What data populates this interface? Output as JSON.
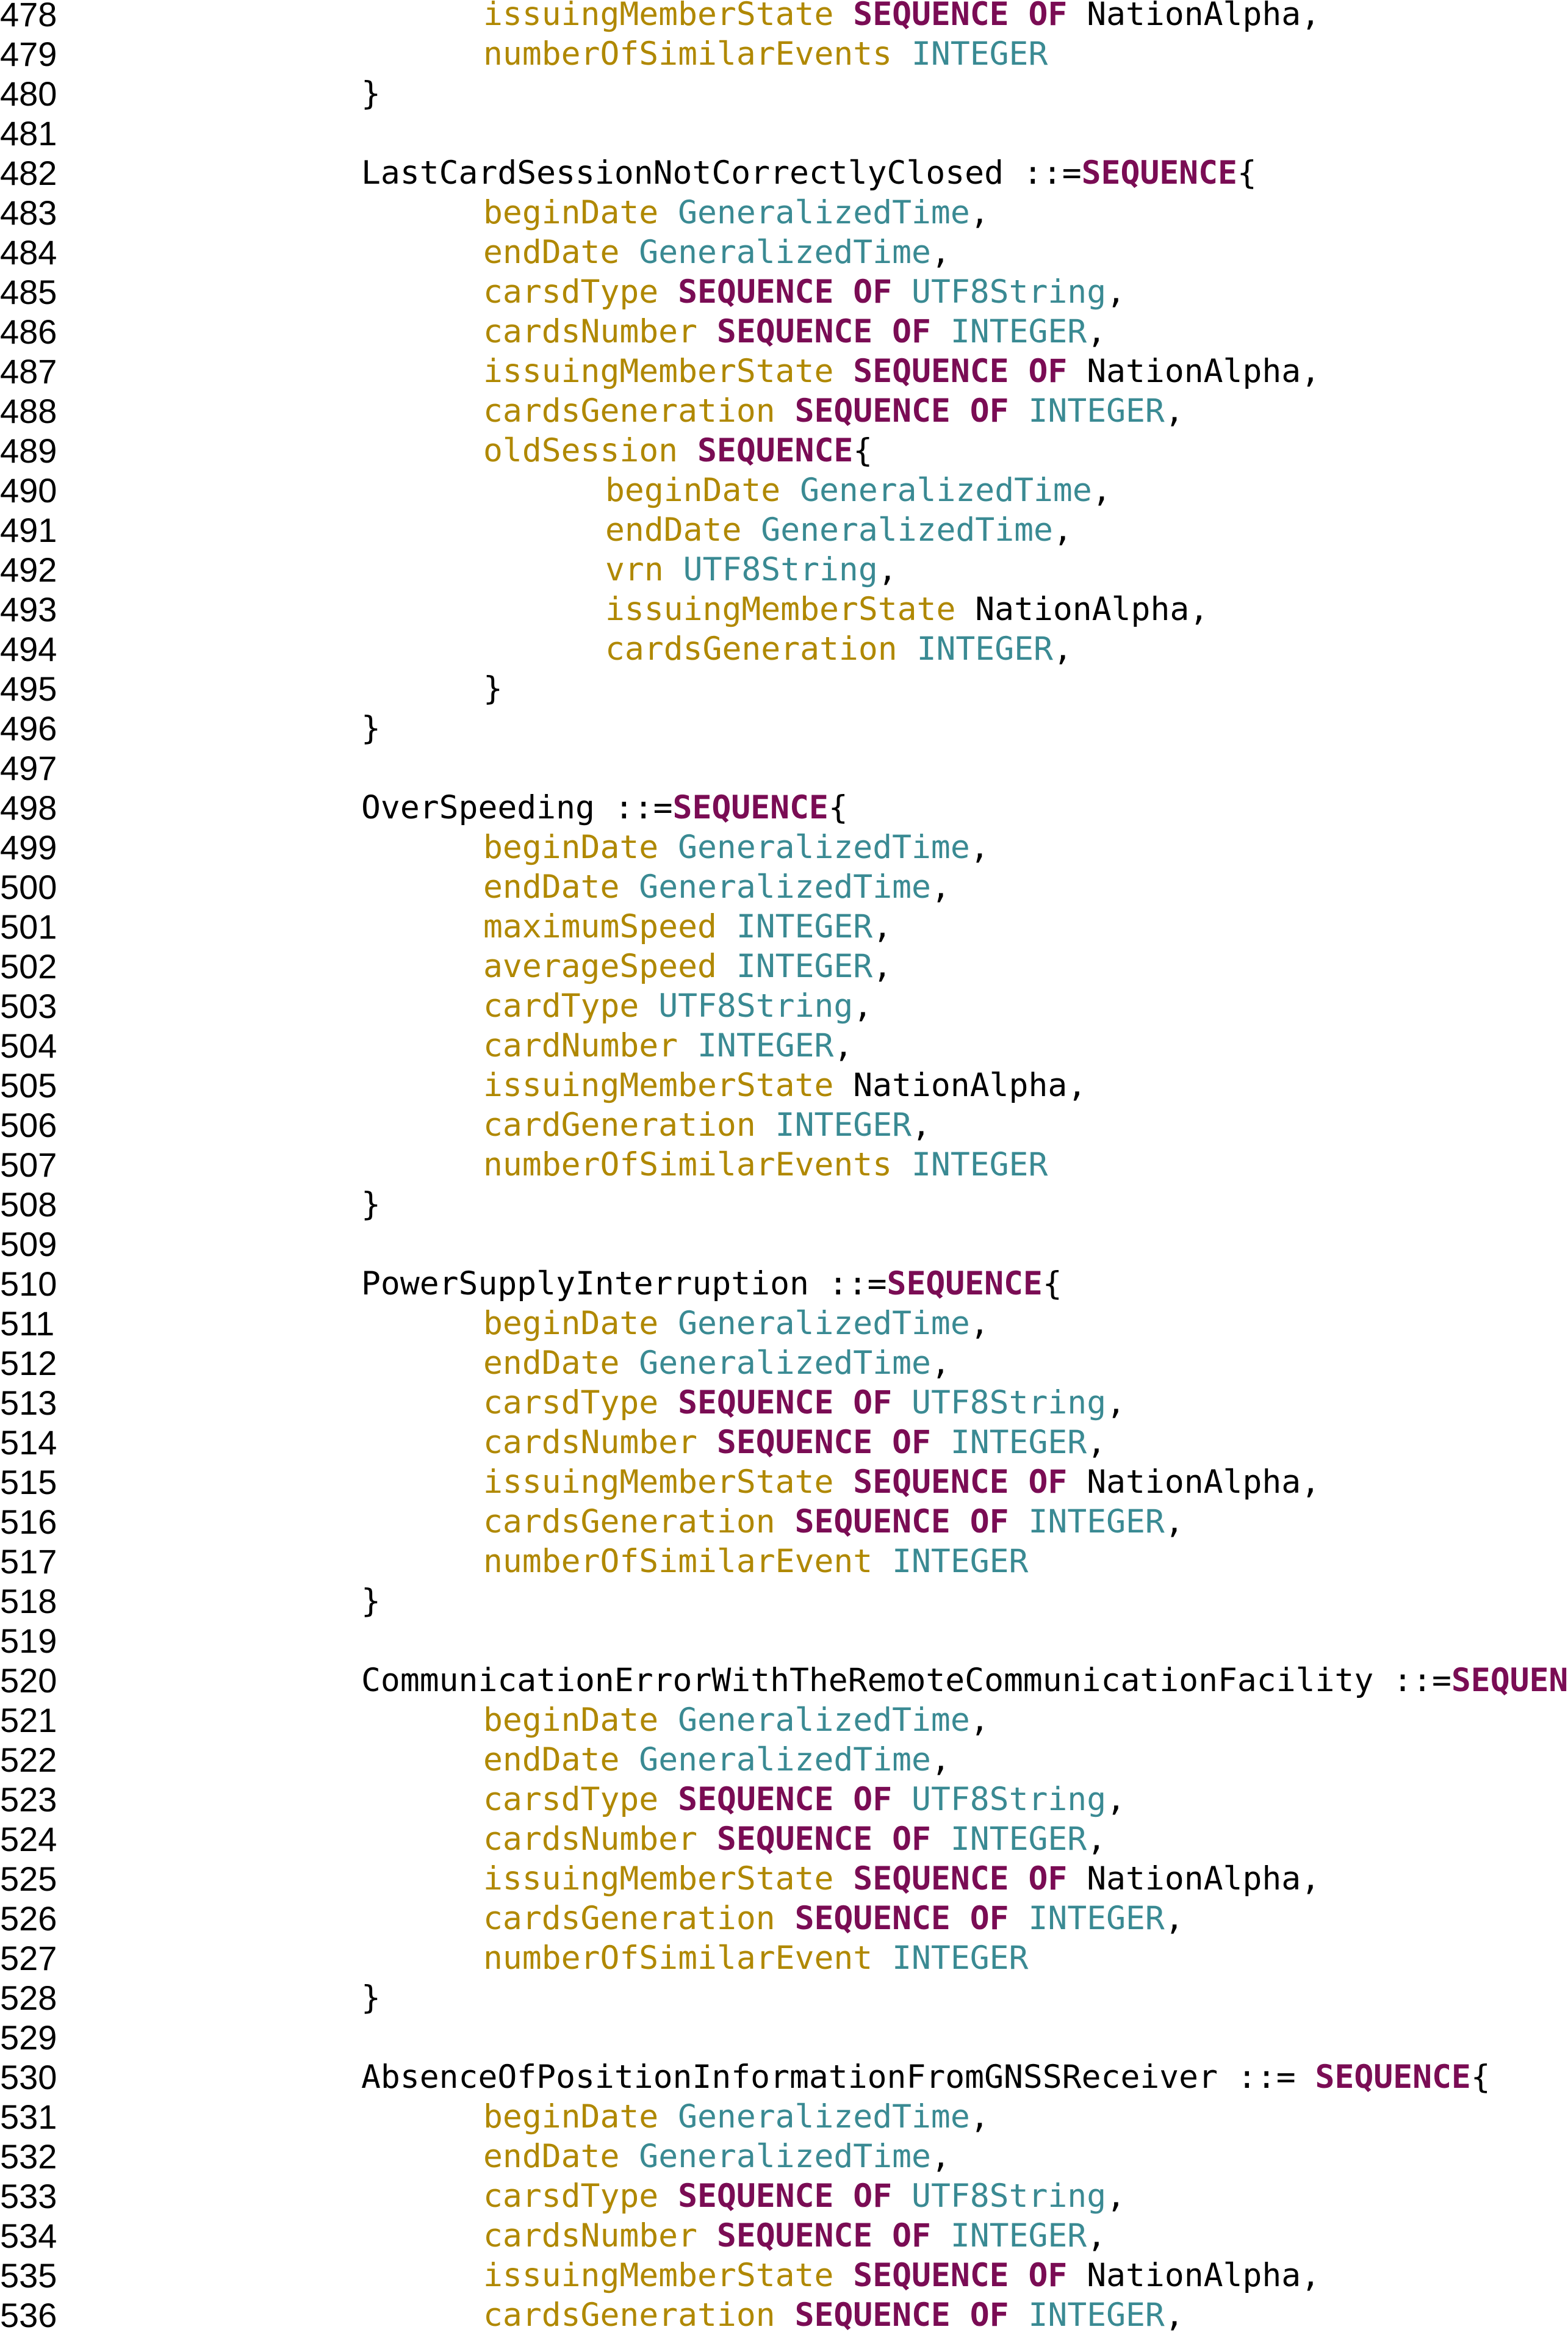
{
  "document": {
    "colors": {
      "plain": "#000000",
      "field": "#b08800",
      "type": "#3a8a93",
      "keyword": "#7a0c54"
    },
    "lines": [
      {
        "n": "478",
        "indent": 2,
        "tokens": [
          [
            "f",
            "issuingMemberState"
          ],
          [
            "p",
            " "
          ],
          [
            "k",
            "SEQUENCE OF"
          ],
          [
            "p",
            " NationAlpha,"
          ]
        ]
      },
      {
        "n": "479",
        "indent": 2,
        "tokens": [
          [
            "f",
            "numberOfSimilarEvents"
          ],
          [
            "p",
            " "
          ],
          [
            "t",
            "INTEGER"
          ]
        ]
      },
      {
        "n": "480",
        "indent": 1,
        "tokens": [
          [
            "p",
            "}"
          ]
        ]
      },
      {
        "n": "481",
        "indent": 0,
        "tokens": []
      },
      {
        "n": "482",
        "indent": 1,
        "tokens": [
          [
            "p",
            "LastCardSessionNotCorrectlyClosed ::="
          ],
          [
            "k",
            "SEQUENCE"
          ],
          [
            "p",
            "{"
          ]
        ]
      },
      {
        "n": "483",
        "indent": 2,
        "tokens": [
          [
            "f",
            "beginDate"
          ],
          [
            "p",
            " "
          ],
          [
            "t",
            "GeneralizedTime"
          ],
          [
            "p",
            ","
          ]
        ]
      },
      {
        "n": "484",
        "indent": 2,
        "tokens": [
          [
            "f",
            "endDate"
          ],
          [
            "p",
            " "
          ],
          [
            "t",
            "GeneralizedTime"
          ],
          [
            "p",
            ","
          ]
        ]
      },
      {
        "n": "485",
        "indent": 2,
        "tokens": [
          [
            "f",
            "carsdType"
          ],
          [
            "p",
            " "
          ],
          [
            "k",
            "SEQUENCE OF"
          ],
          [
            "p",
            " "
          ],
          [
            "t",
            "UTF8String"
          ],
          [
            "p",
            ","
          ]
        ]
      },
      {
        "n": "486",
        "indent": 2,
        "tokens": [
          [
            "f",
            "cardsNumber"
          ],
          [
            "p",
            " "
          ],
          [
            "k",
            "SEQUENCE OF"
          ],
          [
            "p",
            " "
          ],
          [
            "t",
            "INTEGER"
          ],
          [
            "p",
            ","
          ]
        ]
      },
      {
        "n": "487",
        "indent": 2,
        "tokens": [
          [
            "f",
            "issuingMemberState"
          ],
          [
            "p",
            " "
          ],
          [
            "k",
            "SEQUENCE OF"
          ],
          [
            "p",
            " NationAlpha,"
          ]
        ]
      },
      {
        "n": "488",
        "indent": 2,
        "tokens": [
          [
            "f",
            "cardsGeneration"
          ],
          [
            "p",
            " "
          ],
          [
            "k",
            "SEQUENCE OF"
          ],
          [
            "p",
            " "
          ],
          [
            "t",
            "INTEGER"
          ],
          [
            "p",
            ","
          ]
        ]
      },
      {
        "n": "489",
        "indent": 2,
        "tokens": [
          [
            "f",
            "oldSession"
          ],
          [
            "p",
            " "
          ],
          [
            "k",
            "SEQUENCE"
          ],
          [
            "p",
            "{"
          ]
        ]
      },
      {
        "n": "490",
        "indent": 3,
        "tokens": [
          [
            "f",
            "beginDate"
          ],
          [
            "p",
            " "
          ],
          [
            "t",
            "GeneralizedTime"
          ],
          [
            "p",
            ","
          ]
        ]
      },
      {
        "n": "491",
        "indent": 3,
        "tokens": [
          [
            "f",
            "endDate"
          ],
          [
            "p",
            " "
          ],
          [
            "t",
            "GeneralizedTime"
          ],
          [
            "p",
            ","
          ]
        ]
      },
      {
        "n": "492",
        "indent": 3,
        "tokens": [
          [
            "f",
            "vrn"
          ],
          [
            "p",
            " "
          ],
          [
            "t",
            "UTF8String"
          ],
          [
            "p",
            ","
          ]
        ]
      },
      {
        "n": "493",
        "indent": 3,
        "tokens": [
          [
            "f",
            "issuingMemberState"
          ],
          [
            "p",
            " NationAlpha,"
          ]
        ]
      },
      {
        "n": "494",
        "indent": 3,
        "tokens": [
          [
            "f",
            "cardsGeneration"
          ],
          [
            "p",
            " "
          ],
          [
            "t",
            "INTEGER"
          ],
          [
            "p",
            ","
          ]
        ]
      },
      {
        "n": "495",
        "indent": 2,
        "tokens": [
          [
            "p",
            "}"
          ]
        ]
      },
      {
        "n": "496",
        "indent": 1,
        "tokens": [
          [
            "p",
            "}"
          ]
        ]
      },
      {
        "n": "497",
        "indent": 0,
        "tokens": []
      },
      {
        "n": "498",
        "indent": 1,
        "tokens": [
          [
            "p",
            "OverSpeeding ::="
          ],
          [
            "k",
            "SEQUENCE"
          ],
          [
            "p",
            "{"
          ]
        ]
      },
      {
        "n": "499",
        "indent": 2,
        "tokens": [
          [
            "f",
            "beginDate"
          ],
          [
            "p",
            " "
          ],
          [
            "t",
            "GeneralizedTime"
          ],
          [
            "p",
            ","
          ]
        ]
      },
      {
        "n": "500",
        "indent": 2,
        "tokens": [
          [
            "f",
            "endDate"
          ],
          [
            "p",
            " "
          ],
          [
            "t",
            "GeneralizedTime"
          ],
          [
            "p",
            ","
          ]
        ]
      },
      {
        "n": "501",
        "indent": 2,
        "tokens": [
          [
            "f",
            "maximumSpeed"
          ],
          [
            "p",
            " "
          ],
          [
            "t",
            "INTEGER"
          ],
          [
            "p",
            ","
          ]
        ]
      },
      {
        "n": "502",
        "indent": 2,
        "tokens": [
          [
            "f",
            "averageSpeed"
          ],
          [
            "p",
            " "
          ],
          [
            "t",
            "INTEGER"
          ],
          [
            "p",
            ","
          ]
        ]
      },
      {
        "n": "503",
        "indent": 2,
        "tokens": [
          [
            "f",
            "cardType"
          ],
          [
            "p",
            " "
          ],
          [
            "t",
            "UTF8String"
          ],
          [
            "p",
            ","
          ]
        ]
      },
      {
        "n": "504",
        "indent": 2,
        "tokens": [
          [
            "f",
            "cardNumber"
          ],
          [
            "p",
            " "
          ],
          [
            "t",
            "INTEGER"
          ],
          [
            "p",
            ","
          ]
        ]
      },
      {
        "n": "505",
        "indent": 2,
        "tokens": [
          [
            "f",
            "issuingMemberState"
          ],
          [
            "p",
            " NationAlpha,"
          ]
        ]
      },
      {
        "n": "506",
        "indent": 2,
        "tokens": [
          [
            "f",
            "cardGeneration"
          ],
          [
            "p",
            " "
          ],
          [
            "t",
            "INTEGER"
          ],
          [
            "p",
            ","
          ]
        ]
      },
      {
        "n": "507",
        "indent": 2,
        "tokens": [
          [
            "f",
            "numberOfSimilarEvents"
          ],
          [
            "p",
            " "
          ],
          [
            "t",
            "INTEGER"
          ]
        ]
      },
      {
        "n": "508",
        "indent": 1,
        "tokens": [
          [
            "p",
            "}"
          ]
        ]
      },
      {
        "n": "509",
        "indent": 0,
        "tokens": []
      },
      {
        "n": "510",
        "indent": 1,
        "tokens": [
          [
            "p",
            "PowerSupplyInterruption ::="
          ],
          [
            "k",
            "SEQUENCE"
          ],
          [
            "p",
            "{"
          ]
        ]
      },
      {
        "n": "511",
        "indent": 2,
        "tokens": [
          [
            "f",
            "beginDate"
          ],
          [
            "p",
            " "
          ],
          [
            "t",
            "GeneralizedTime"
          ],
          [
            "p",
            ","
          ]
        ]
      },
      {
        "n": "512",
        "indent": 2,
        "tokens": [
          [
            "f",
            "endDate"
          ],
          [
            "p",
            " "
          ],
          [
            "t",
            "GeneralizedTime"
          ],
          [
            "p",
            ","
          ]
        ]
      },
      {
        "n": "513",
        "indent": 2,
        "tokens": [
          [
            "f",
            "carsdType"
          ],
          [
            "p",
            " "
          ],
          [
            "k",
            "SEQUENCE OF"
          ],
          [
            "p",
            " "
          ],
          [
            "t",
            "UTF8String"
          ],
          [
            "p",
            ","
          ]
        ]
      },
      {
        "n": "514",
        "indent": 2,
        "tokens": [
          [
            "f",
            "cardsNumber"
          ],
          [
            "p",
            " "
          ],
          [
            "k",
            "SEQUENCE OF"
          ],
          [
            "p",
            " "
          ],
          [
            "t",
            "INTEGER"
          ],
          [
            "p",
            ","
          ]
        ]
      },
      {
        "n": "515",
        "indent": 2,
        "tokens": [
          [
            "f",
            "issuingMemberState"
          ],
          [
            "p",
            " "
          ],
          [
            "k",
            "SEQUENCE OF"
          ],
          [
            "p",
            " NationAlpha,"
          ]
        ]
      },
      {
        "n": "516",
        "indent": 2,
        "tokens": [
          [
            "f",
            "cardsGeneration"
          ],
          [
            "p",
            " "
          ],
          [
            "k",
            "SEQUENCE OF"
          ],
          [
            "p",
            " "
          ],
          [
            "t",
            "INTEGER"
          ],
          [
            "p",
            ","
          ]
        ]
      },
      {
        "n": "517",
        "indent": 2,
        "tokens": [
          [
            "f",
            "numberOfSimilarEvent"
          ],
          [
            "p",
            " "
          ],
          [
            "t",
            "INTEGER"
          ]
        ]
      },
      {
        "n": "518",
        "indent": 1,
        "tokens": [
          [
            "p",
            "}"
          ]
        ]
      },
      {
        "n": "519",
        "indent": 0,
        "tokens": []
      },
      {
        "n": "520",
        "indent": 1,
        "tokens": [
          [
            "p",
            "CommunicationErrorWithTheRemoteCommunicationFacility ::="
          ],
          [
            "k",
            "SEQUENCE"
          ],
          [
            "p",
            "{"
          ]
        ]
      },
      {
        "n": "521",
        "indent": 2,
        "tokens": [
          [
            "f",
            "beginDate"
          ],
          [
            "p",
            " "
          ],
          [
            "t",
            "GeneralizedTime"
          ],
          [
            "p",
            ","
          ]
        ]
      },
      {
        "n": "522",
        "indent": 2,
        "tokens": [
          [
            "f",
            "endDate"
          ],
          [
            "p",
            " "
          ],
          [
            "t",
            "GeneralizedTime"
          ],
          [
            "p",
            ","
          ]
        ]
      },
      {
        "n": "523",
        "indent": 2,
        "tokens": [
          [
            "f",
            "carsdType"
          ],
          [
            "p",
            " "
          ],
          [
            "k",
            "SEQUENCE OF"
          ],
          [
            "p",
            " "
          ],
          [
            "t",
            "UTF8String"
          ],
          [
            "p",
            ","
          ]
        ]
      },
      {
        "n": "524",
        "indent": 2,
        "tokens": [
          [
            "f",
            "cardsNumber"
          ],
          [
            "p",
            " "
          ],
          [
            "k",
            "SEQUENCE OF"
          ],
          [
            "p",
            " "
          ],
          [
            "t",
            "INTEGER"
          ],
          [
            "p",
            ","
          ]
        ]
      },
      {
        "n": "525",
        "indent": 2,
        "tokens": [
          [
            "f",
            "issuingMemberState"
          ],
          [
            "p",
            " "
          ],
          [
            "k",
            "SEQUENCE OF"
          ],
          [
            "p",
            " NationAlpha,"
          ]
        ]
      },
      {
        "n": "526",
        "indent": 2,
        "tokens": [
          [
            "f",
            "cardsGeneration"
          ],
          [
            "p",
            " "
          ],
          [
            "k",
            "SEQUENCE OF"
          ],
          [
            "p",
            " "
          ],
          [
            "t",
            "INTEGER"
          ],
          [
            "p",
            ","
          ]
        ]
      },
      {
        "n": "527",
        "indent": 2,
        "tokens": [
          [
            "f",
            "numberOfSimilarEvent"
          ],
          [
            "p",
            " "
          ],
          [
            "t",
            "INTEGER"
          ]
        ]
      },
      {
        "n": "528",
        "indent": 1,
        "tokens": [
          [
            "p",
            "}"
          ]
        ]
      },
      {
        "n": "529",
        "indent": 0,
        "tokens": []
      },
      {
        "n": "530",
        "indent": 1,
        "tokens": [
          [
            "p",
            "AbsenceOfPositionInformationFromGNSSReceiver ::= "
          ],
          [
            "k",
            "SEQUENCE"
          ],
          [
            "p",
            "{"
          ]
        ]
      },
      {
        "n": "531",
        "indent": 2,
        "tokens": [
          [
            "f",
            "beginDate"
          ],
          [
            "p",
            " "
          ],
          [
            "t",
            "GeneralizedTime"
          ],
          [
            "p",
            ","
          ]
        ]
      },
      {
        "n": "532",
        "indent": 2,
        "tokens": [
          [
            "f",
            "endDate"
          ],
          [
            "p",
            " "
          ],
          [
            "t",
            "GeneralizedTime"
          ],
          [
            "p",
            ","
          ]
        ]
      },
      {
        "n": "533",
        "indent": 2,
        "tokens": [
          [
            "f",
            "carsdType"
          ],
          [
            "p",
            " "
          ],
          [
            "k",
            "SEQUENCE OF"
          ],
          [
            "p",
            " "
          ],
          [
            "t",
            "UTF8String"
          ],
          [
            "p",
            ","
          ]
        ]
      },
      {
        "n": "534",
        "indent": 2,
        "tokens": [
          [
            "f",
            "cardsNumber"
          ],
          [
            "p",
            " "
          ],
          [
            "k",
            "SEQUENCE OF"
          ],
          [
            "p",
            " "
          ],
          [
            "t",
            "INTEGER"
          ],
          [
            "p",
            ","
          ]
        ]
      },
      {
        "n": "535",
        "indent": 2,
        "tokens": [
          [
            "f",
            "issuingMemberState"
          ],
          [
            "p",
            " "
          ],
          [
            "k",
            "SEQUENCE OF"
          ],
          [
            "p",
            " NationAlpha,"
          ]
        ]
      },
      {
        "n": "536",
        "indent": 2,
        "tokens": [
          [
            "f",
            "cardsGeneration"
          ],
          [
            "p",
            " "
          ],
          [
            "k",
            "SEQUENCE OF"
          ],
          [
            "p",
            " "
          ],
          [
            "t",
            "INTEGER"
          ],
          [
            "p",
            ","
          ]
        ]
      }
    ]
  }
}
